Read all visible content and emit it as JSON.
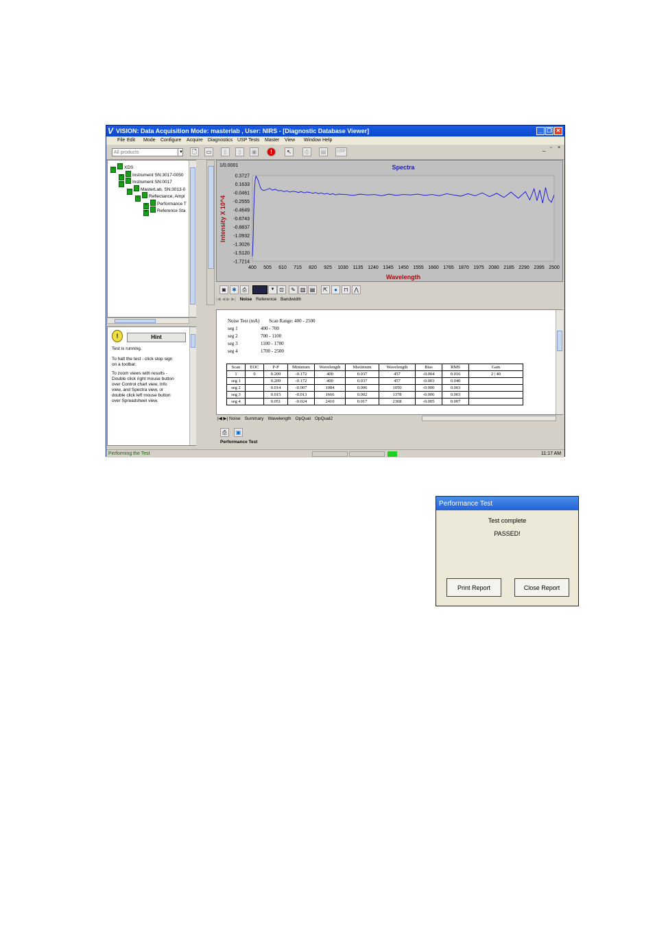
{
  "window": {
    "title": "VISION: Data Acquisition Mode: masterlab , User: NIRS - [Diagnostic Database Viewer]",
    "logo": "V",
    "menu": [
      "File",
      "Edit",
      "Mode",
      "Configure",
      "Acquire",
      "Diagnostics",
      "USP Tests",
      "Master",
      "View",
      "Window",
      "Help"
    ],
    "combo_placeholder": "All products",
    "toolbar_icons": [
      "new-icon",
      "open-icon",
      "copy-icon",
      "paste-icon",
      "save-icon",
      "stop-icon",
      "cursor-help-icon",
      "print-icon",
      "report-icon",
      "usp-icon"
    ]
  },
  "tree": {
    "items": [
      {
        "label": "XDS",
        "pm": "−"
      },
      {
        "label": "Instrument SN:3017-0050",
        "pm": "+"
      },
      {
        "label": "Instrument SN:0017",
        "pm": "−"
      },
      {
        "label": "MasterLab, SN:3013-0",
        "pm": "−"
      },
      {
        "label": "Reflectance, Ampl",
        "pm": "−"
      },
      {
        "label": "Performance T",
        "pm": "+"
      },
      {
        "label": "Reference Sta",
        "pm": "+"
      }
    ]
  },
  "hint": {
    "title": "Hint",
    "lines": [
      "Test is running.",
      "To halt the test - click stop sign",
      "on a toolbar.",
      "To zoom views with results -",
      "Double click right mouse button",
      "over Control chart view, Info",
      "view, and Spectra view, or",
      "double click left mouse button",
      "over Spreadsheet view."
    ]
  },
  "chart_data": {
    "type": "line",
    "title": "Spectra",
    "xlabel": "Wavelength",
    "ylabel": "Intensity X 10^4",
    "scale_label": "1/0.0001",
    "xlim": [
      400,
      2500
    ],
    "ylim": [
      -1.7214,
      0.3727
    ],
    "x_ticks": [
      "400",
      "505",
      "610",
      "715",
      "820",
      "925",
      "1030",
      "1135",
      "1240",
      "1345",
      "1450",
      "1555",
      "1660",
      "1765",
      "1870",
      "1975",
      "2080",
      "2185",
      "2290",
      "2395",
      "2500"
    ],
    "y_ticks": [
      "0.3727",
      "0.1633",
      "-0.0461",
      "-0.2555",
      "-0.4649",
      "-0.6743",
      "-0.8837",
      "-1.0932",
      "-1.3026",
      "-1.5120",
      "-1.7214"
    ],
    "series": [
      {
        "x": [
          400,
          405,
          410,
          415,
          420,
          425,
          430,
          440,
          450,
          460,
          470,
          480,
          500,
          520,
          540,
          560,
          580,
          600,
          620,
          640,
          660,
          680,
          700,
          720,
          740,
          760,
          780,
          800,
          820,
          840,
          860,
          880,
          900,
          920,
          940,
          960,
          980,
          1000,
          1050,
          1100,
          1150,
          1200,
          1250,
          1300,
          1350,
          1400,
          1450,
          1500,
          1550,
          1600,
          1650,
          1700,
          1750,
          1800,
          1850,
          1900,
          1950,
          2000,
          2050,
          2100,
          2150,
          2200,
          2250,
          2300,
          2330,
          2360,
          2380,
          2400,
          2420,
          2440,
          2460,
          2480,
          2500
        ],
        "y": [
          -1.6,
          -1.2,
          -0.4,
          0.05,
          0.28,
          0.36,
          0.33,
          0.25,
          0.14,
          0.05,
          0.02,
          0.01,
          0.03,
          0.06,
          0.02,
          0.04,
          0.0,
          0.01,
          -0.02,
          0.0,
          -0.03,
          -0.01,
          -0.02,
          -0.04,
          -0.02,
          -0.05,
          -0.03,
          -0.04,
          -0.06,
          -0.04,
          -0.07,
          -0.05,
          -0.08,
          -0.06,
          -0.09,
          -0.07,
          -0.1,
          -0.08,
          -0.09,
          -0.11,
          -0.08,
          -0.1,
          -0.09,
          -0.12,
          -0.08,
          -0.11,
          -0.09,
          -0.1,
          -0.08,
          -0.11,
          -0.09,
          -0.12,
          -0.07,
          -0.1,
          -0.13,
          -0.07,
          -0.12,
          -0.05,
          -0.14,
          -0.06,
          -0.16,
          -0.03,
          -0.18,
          -0.02,
          -0.22,
          0.05,
          -0.24,
          0.02,
          -0.3,
          0.08,
          -0.2,
          -0.28,
          -0.1
        ]
      }
    ]
  },
  "chart_tabs": [
    "Noise",
    "Reference",
    "Bandwidth"
  ],
  "report": {
    "heading": "Noise Test (mA)",
    "scan_range": "Scan Range: 400 - 2500",
    "segments": [
      {
        "name": "seg 1",
        "range": "400 - 700"
      },
      {
        "name": "seg 2",
        "range": "700 - 1100"
      },
      {
        "name": "seg 3",
        "range": "1100 - 1700"
      },
      {
        "name": "seg 4",
        "range": "1700 - 2500"
      }
    ],
    "columns": [
      "Scan",
      "EOC",
      "P-P",
      "Minimum",
      "Wavelength",
      "Maximum",
      "Wavelength",
      "Bias",
      "RMS",
      "Gain"
    ],
    "rows": [
      [
        "1",
        "0",
        "0.209",
        "-0.172",
        "400",
        "0.037",
        "457",
        "-0.004",
        "0.016",
        "2 | 40"
      ],
      [
        "seg 1",
        "",
        "0.209",
        "-0.172",
        "400",
        "0.037",
        "457",
        "-0.003",
        "0.040",
        ""
      ],
      [
        "seg 2",
        "",
        "0.014",
        "-0.007",
        "1084",
        "0.006",
        "1050",
        "-0.000",
        "0.003",
        ""
      ],
      [
        "seg 3",
        "",
        "0.015",
        "-0.013",
        "1666",
        "0.002",
        "1378",
        "-0.006",
        "0.003",
        ""
      ],
      [
        "seg 4",
        "",
        "0.051",
        "-0.024",
        "2410",
        "0.017",
        "2368",
        "-0.005",
        "0.007",
        ""
      ]
    ],
    "tabs": [
      "Noise",
      "Summary",
      "Wavelength",
      "OpQual",
      "OpQual2"
    ]
  },
  "bottom_tab": "Performance Test",
  "status": {
    "text": "Performing the Test",
    "time": "11:17 AM"
  },
  "dialog": {
    "title": "Performance Test",
    "line1": "Test complete",
    "line2": "PASSED!",
    "print_label": "Print Report",
    "close_label": "Close Report"
  }
}
